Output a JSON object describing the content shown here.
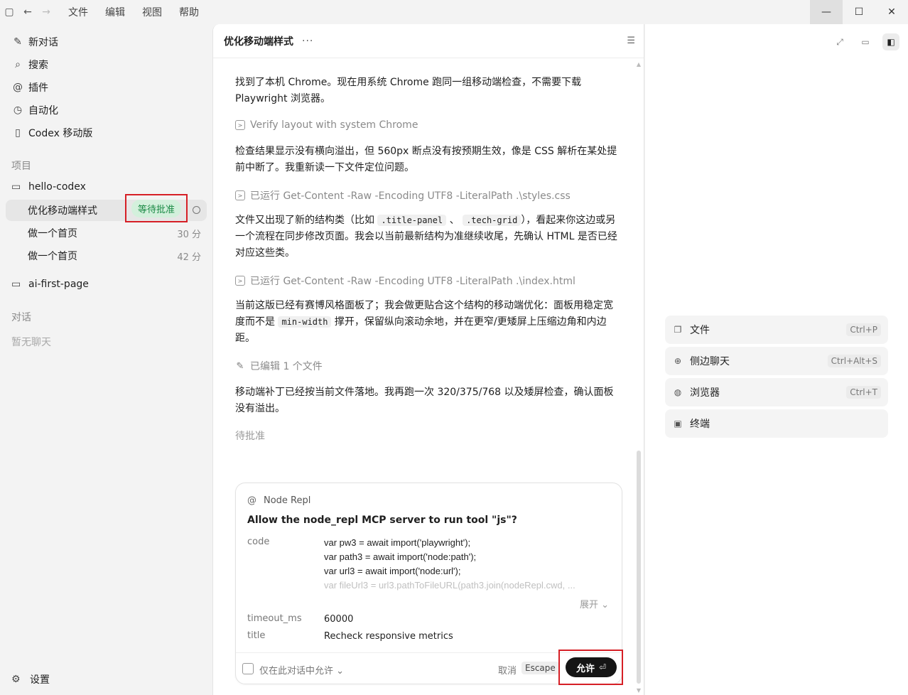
{
  "menu": [
    "文件",
    "编辑",
    "视图",
    "帮助"
  ],
  "sidebar": {
    "nav": [
      {
        "label": "新对话",
        "icon": "edit-icon"
      },
      {
        "label": "搜索",
        "icon": "search-icon"
      },
      {
        "label": "插件",
        "icon": "at-icon"
      },
      {
        "label": "自动化",
        "icon": "clock-icon"
      },
      {
        "label": "Codex 移动版",
        "icon": "phone-icon"
      }
    ],
    "projects_label": "项目",
    "projects": [
      {
        "name": "hello-codex"
      },
      {
        "name": "ai-first-page"
      }
    ],
    "conversations": [
      {
        "title": "优化移动端样式",
        "badge": "等待批准"
      },
      {
        "title": "做一个首页",
        "time": "30 分"
      },
      {
        "title": "做一个首页",
        "time": "42 分"
      }
    ],
    "chats_label": "对话",
    "no_chats": "暂无聊天",
    "settings": "设置"
  },
  "main": {
    "title": "优化移动端样式",
    "messages": {
      "p1": "找到了本机 Chrome。现在用系统 Chrome 跑同一组移动端检查，不需要下载 Playwright 浏览器。",
      "s1": "Verify layout with system Chrome",
      "p2": "检查结果显示没有横向溢出，但 560px 断点没有按预期生效，像是 CSS 解析在某处提前中断了。我重新读一下文件定位问题。",
      "s2": "已运行 Get-Content -Raw -Encoding UTF8 -LiteralPath .\\styles.css",
      "p3a": "文件又出现了新的结构类（比如 ",
      "p3c1": ".title-panel",
      "p3b": " 、 ",
      "p3c2": ".tech-grid",
      "p3d": "），看起来你这边或另一个流程在同步修改页面。我会以当前最新结构为准继续收尾，先确认 HTML 是否已经对应这些类。",
      "s3": "已运行 Get-Content -Raw -Encoding UTF8 -LiteralPath .\\index.html",
      "p4a": "当前这版已经有赛博风格面板了；我会做更贴合这个结构的移动端优化：面板用稳定宽度而不是 ",
      "p4c": "min-width",
      "p4b": " 撑开，保留纵向滚动余地，并在更窄/更矮屏上压缩边角和内边距。",
      "s4": "已编辑 1 个文件",
      "p5": "移动端补丁已经按当前文件落地。我再跑一次 320/375/768 以及矮屏检查，确认面板没有溢出。",
      "pending": "待批准"
    },
    "approval": {
      "source": "Node Repl",
      "question": "Allow the node_repl MCP server to run tool \"js\"?",
      "code_key": "code",
      "code_lines": [
        "var pw3 = await import('playwright');",
        "var path3 = await import('node:path');",
        "var url3 = await import('node:url');",
        "var fileUrl3 = url3.pathToFileURL(path3.join(nodeRepl.cwd, ..."
      ],
      "expand": "展开",
      "timeout_key": "timeout_ms",
      "timeout_val": "60000",
      "title_key": "title",
      "title_val": "Recheck responsive metrics",
      "only_this": "仅在此对话中允许",
      "cancel": "取消",
      "escape": "Escape",
      "allow": "允许"
    }
  },
  "right_panel": {
    "items": [
      {
        "label": "文件",
        "shortcut": "Ctrl+P",
        "icon": "files-icon"
      },
      {
        "label": "侧边聊天",
        "shortcut": "Ctrl+Alt+S",
        "icon": "side-chat-icon"
      },
      {
        "label": "浏览器",
        "shortcut": "Ctrl+T",
        "icon": "globe-icon"
      },
      {
        "label": "终端",
        "shortcut": "",
        "icon": "terminal-icon"
      }
    ]
  },
  "colors": {
    "highlight_red": "#d61f26",
    "badge_green_bg": "#d3f0dc",
    "badge_green_text": "#1a8a45",
    "allow_button": "#151515"
  }
}
